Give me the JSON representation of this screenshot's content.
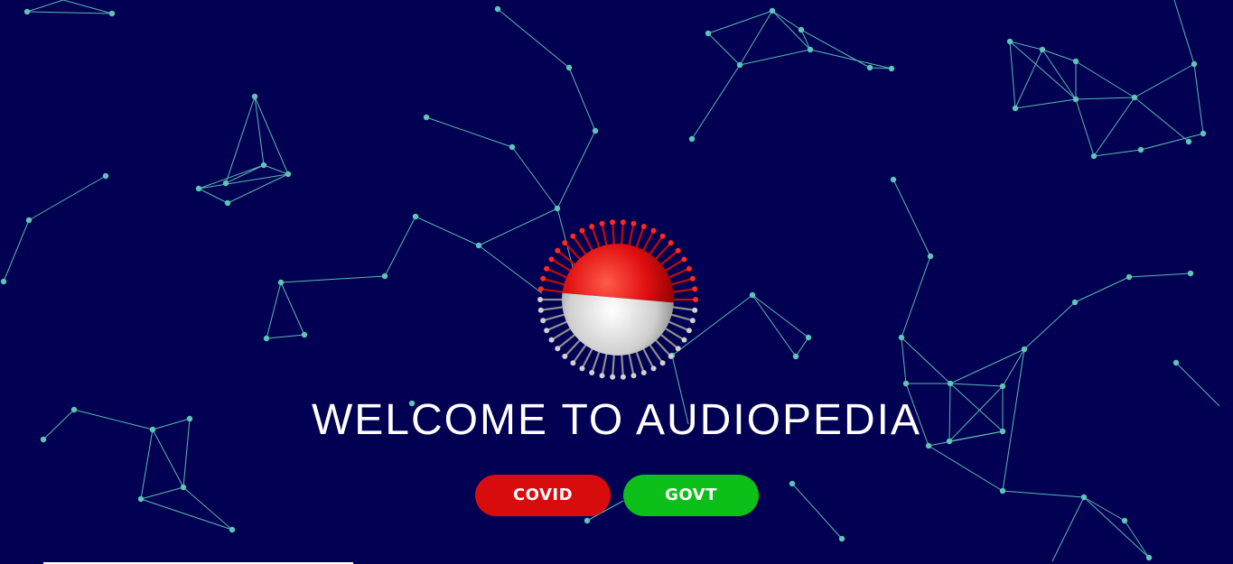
{
  "hero": {
    "title": "WELCOME TO AUDIOPEDIA"
  },
  "buttons": {
    "covid_label": "COVID",
    "govt_label": "GOVT"
  },
  "colors": {
    "background": "#020052",
    "network": "#5fc4b8",
    "covid_button": "#d80c0c",
    "govt_button": "#0cbf19",
    "virus_top": "#e01010",
    "virus_bottom": "#d8d8d8"
  },
  "icons": {
    "hero_graphic": "coronavirus-icon"
  }
}
